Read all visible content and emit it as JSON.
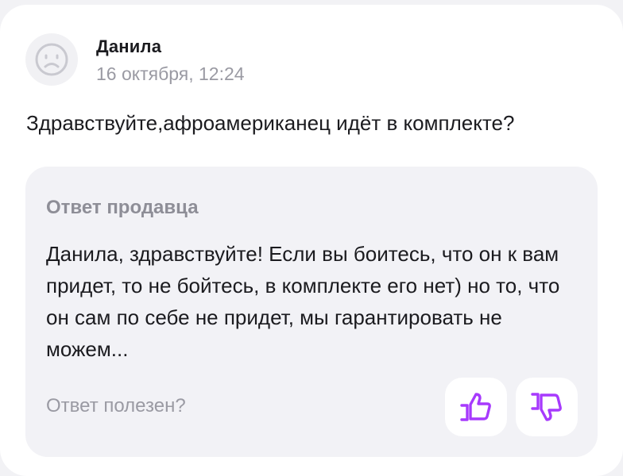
{
  "review": {
    "author": "Данила",
    "date": "16 октября, 12:24",
    "avatar_icon": "sad-face-icon",
    "text": "Здравствуйте,афроамериканец идёт в комплекте?"
  },
  "answer": {
    "title": "Ответ продавца",
    "text": "Данила, здравствуйте! Если вы боитесь, что он к вам придет, то не бойтесь, в комплекте его нет) но то, что он сам по себе не придет, мы гарантировать не можем...",
    "helpful_label": "Ответ полезен?",
    "like_icon": "thumbs-up-icon",
    "dislike_icon": "thumbs-down-icon"
  },
  "colors": {
    "accent": "#a73afd",
    "background": "#f2f2f5",
    "card": "#ffffff",
    "answer_box": "#f2f2f6",
    "muted_text": "#9a9aa3"
  }
}
